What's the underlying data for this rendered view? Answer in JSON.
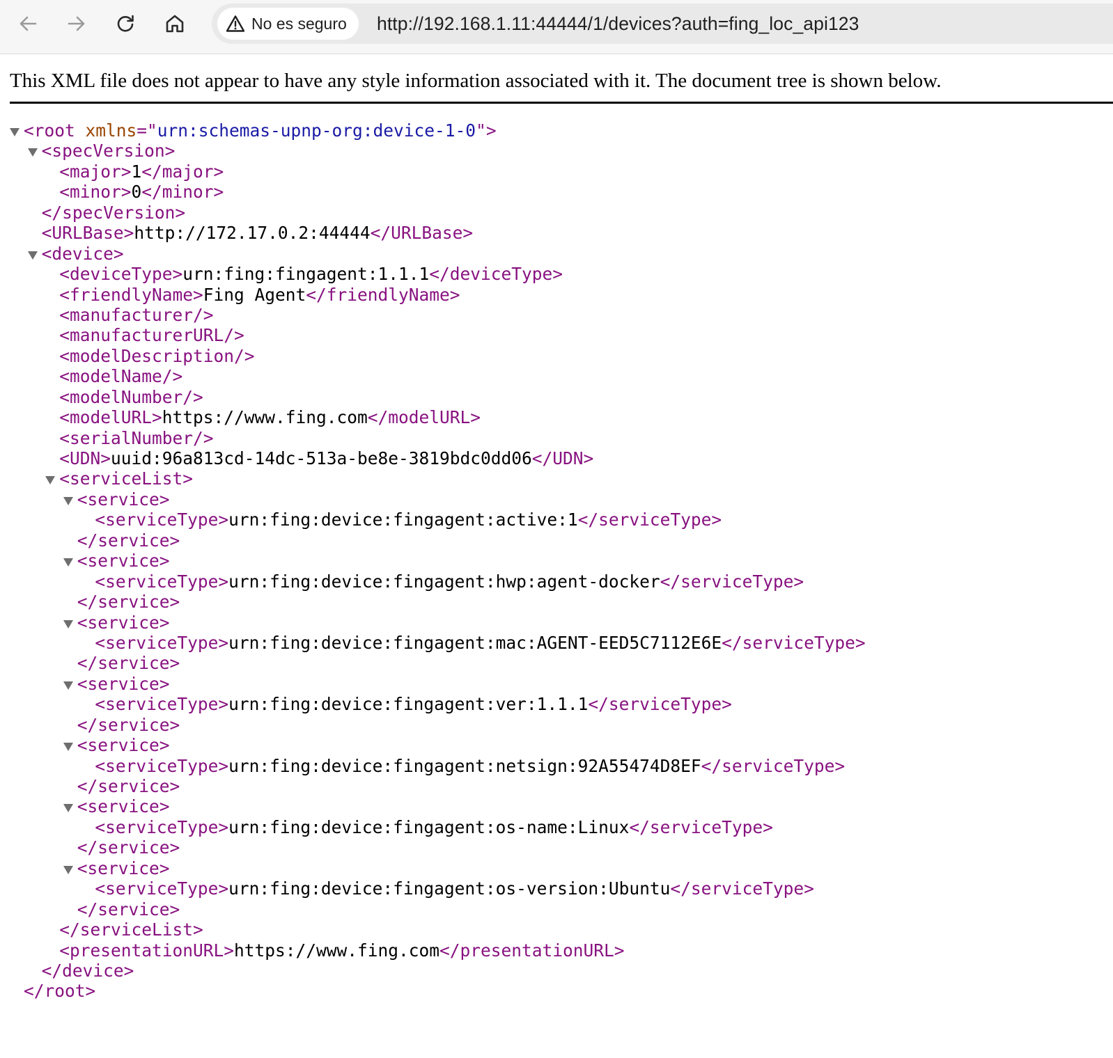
{
  "browser": {
    "security_label": "No es seguro",
    "url": "http://192.168.1.11:44444/1/devices?auth=fing_loc_api123"
  },
  "xml_viewer": {
    "notice": "This XML file does not appear to have any style information associated with it. The document tree is shown below.",
    "lines": [
      {
        "indent": 0,
        "arrow": true,
        "parts": [
          [
            "tag",
            "<root"
          ],
          [
            "an",
            " xmlns"
          ],
          [
            "tag",
            "=\""
          ],
          [
            "av",
            "urn:schemas-upnp-org:device-1-0"
          ],
          [
            "tag",
            "\">"
          ]
        ]
      },
      {
        "indent": 1,
        "arrow": true,
        "parts": [
          [
            "tag",
            "<specVersion>"
          ]
        ]
      },
      {
        "indent": 2,
        "arrow": false,
        "parts": [
          [
            "tag",
            "<major>"
          ],
          [
            "val",
            "1"
          ],
          [
            "tag",
            "</major>"
          ]
        ]
      },
      {
        "indent": 2,
        "arrow": false,
        "parts": [
          [
            "tag",
            "<minor>"
          ],
          [
            "val",
            "0"
          ],
          [
            "tag",
            "</minor>"
          ]
        ]
      },
      {
        "indent": 1,
        "arrow": false,
        "parts": [
          [
            "tag",
            "</specVersion>"
          ]
        ]
      },
      {
        "indent": 1,
        "arrow": false,
        "parts": [
          [
            "tag",
            "<URLBase>"
          ],
          [
            "val",
            "http://172.17.0.2:44444"
          ],
          [
            "tag",
            "</URLBase>"
          ]
        ]
      },
      {
        "indent": 1,
        "arrow": true,
        "parts": [
          [
            "tag",
            "<device>"
          ]
        ]
      },
      {
        "indent": 2,
        "arrow": false,
        "parts": [
          [
            "tag",
            "<deviceType>"
          ],
          [
            "val",
            "urn:fing:fingagent:1.1.1"
          ],
          [
            "tag",
            "</deviceType>"
          ]
        ]
      },
      {
        "indent": 2,
        "arrow": false,
        "parts": [
          [
            "tag",
            "<friendlyName>"
          ],
          [
            "val",
            "Fing Agent"
          ],
          [
            "tag",
            "</friendlyName>"
          ]
        ]
      },
      {
        "indent": 2,
        "arrow": false,
        "parts": [
          [
            "tag",
            "<manufacturer/>"
          ]
        ]
      },
      {
        "indent": 2,
        "arrow": false,
        "parts": [
          [
            "tag",
            "<manufacturerURL/>"
          ]
        ]
      },
      {
        "indent": 2,
        "arrow": false,
        "parts": [
          [
            "tag",
            "<modelDescription/>"
          ]
        ]
      },
      {
        "indent": 2,
        "arrow": false,
        "parts": [
          [
            "tag",
            "<modelName/>"
          ]
        ]
      },
      {
        "indent": 2,
        "arrow": false,
        "parts": [
          [
            "tag",
            "<modelNumber/>"
          ]
        ]
      },
      {
        "indent": 2,
        "arrow": false,
        "parts": [
          [
            "tag",
            "<modelURL>"
          ],
          [
            "val",
            "https://www.fing.com"
          ],
          [
            "tag",
            "</modelURL>"
          ]
        ]
      },
      {
        "indent": 2,
        "arrow": false,
        "parts": [
          [
            "tag",
            "<serialNumber/>"
          ]
        ]
      },
      {
        "indent": 2,
        "arrow": false,
        "parts": [
          [
            "tag",
            "<UDN>"
          ],
          [
            "val",
            "uuid:96a813cd-14dc-513a-be8e-3819bdc0dd06"
          ],
          [
            "tag",
            "</UDN>"
          ]
        ]
      },
      {
        "indent": 2,
        "arrow": true,
        "parts": [
          [
            "tag",
            "<serviceList>"
          ]
        ]
      },
      {
        "indent": 3,
        "arrow": true,
        "parts": [
          [
            "tag",
            "<service>"
          ]
        ]
      },
      {
        "indent": 4,
        "arrow": false,
        "parts": [
          [
            "tag",
            "<serviceType>"
          ],
          [
            "val",
            "urn:fing:device:fingagent:active:1"
          ],
          [
            "tag",
            "</serviceType>"
          ]
        ]
      },
      {
        "indent": 3,
        "arrow": false,
        "parts": [
          [
            "tag",
            "</service>"
          ]
        ]
      },
      {
        "indent": 3,
        "arrow": true,
        "parts": [
          [
            "tag",
            "<service>"
          ]
        ]
      },
      {
        "indent": 4,
        "arrow": false,
        "parts": [
          [
            "tag",
            "<serviceType>"
          ],
          [
            "val",
            "urn:fing:device:fingagent:hwp:agent-docker"
          ],
          [
            "tag",
            "</serviceType>"
          ]
        ]
      },
      {
        "indent": 3,
        "arrow": false,
        "parts": [
          [
            "tag",
            "</service>"
          ]
        ]
      },
      {
        "indent": 3,
        "arrow": true,
        "parts": [
          [
            "tag",
            "<service>"
          ]
        ]
      },
      {
        "indent": 4,
        "arrow": false,
        "parts": [
          [
            "tag",
            "<serviceType>"
          ],
          [
            "val",
            "urn:fing:device:fingagent:mac:AGENT-EED5C7112E6E"
          ],
          [
            "tag",
            "</serviceType>"
          ]
        ]
      },
      {
        "indent": 3,
        "arrow": false,
        "parts": [
          [
            "tag",
            "</service>"
          ]
        ]
      },
      {
        "indent": 3,
        "arrow": true,
        "parts": [
          [
            "tag",
            "<service>"
          ]
        ]
      },
      {
        "indent": 4,
        "arrow": false,
        "parts": [
          [
            "tag",
            "<serviceType>"
          ],
          [
            "val",
            "urn:fing:device:fingagent:ver:1.1.1"
          ],
          [
            "tag",
            "</serviceType>"
          ]
        ]
      },
      {
        "indent": 3,
        "arrow": false,
        "parts": [
          [
            "tag",
            "</service>"
          ]
        ]
      },
      {
        "indent": 3,
        "arrow": true,
        "parts": [
          [
            "tag",
            "<service>"
          ]
        ]
      },
      {
        "indent": 4,
        "arrow": false,
        "parts": [
          [
            "tag",
            "<serviceType>"
          ],
          [
            "val",
            "urn:fing:device:fingagent:netsign:92A55474D8EF"
          ],
          [
            "tag",
            "</serviceType>"
          ]
        ]
      },
      {
        "indent": 3,
        "arrow": false,
        "parts": [
          [
            "tag",
            "</service>"
          ]
        ]
      },
      {
        "indent": 3,
        "arrow": true,
        "parts": [
          [
            "tag",
            "<service>"
          ]
        ]
      },
      {
        "indent": 4,
        "arrow": false,
        "parts": [
          [
            "tag",
            "<serviceType>"
          ],
          [
            "val",
            "urn:fing:device:fingagent:os-name:Linux"
          ],
          [
            "tag",
            "</serviceType>"
          ]
        ]
      },
      {
        "indent": 3,
        "arrow": false,
        "parts": [
          [
            "tag",
            "</service>"
          ]
        ]
      },
      {
        "indent": 3,
        "arrow": true,
        "parts": [
          [
            "tag",
            "<service>"
          ]
        ]
      },
      {
        "indent": 4,
        "arrow": false,
        "parts": [
          [
            "tag",
            "<serviceType>"
          ],
          [
            "val",
            "urn:fing:device:fingagent:os-version:Ubuntu"
          ],
          [
            "tag",
            "</serviceType>"
          ]
        ]
      },
      {
        "indent": 3,
        "arrow": false,
        "parts": [
          [
            "tag",
            "</service>"
          ]
        ]
      },
      {
        "indent": 2,
        "arrow": false,
        "parts": [
          [
            "tag",
            "</serviceList>"
          ]
        ]
      },
      {
        "indent": 2,
        "arrow": false,
        "parts": [
          [
            "tag",
            "<presentationURL>"
          ],
          [
            "val",
            "https://www.fing.com"
          ],
          [
            "tag",
            "</presentationURL>"
          ]
        ]
      },
      {
        "indent": 1,
        "arrow": false,
        "parts": [
          [
            "tag",
            "</device>"
          ]
        ]
      },
      {
        "indent": 0,
        "arrow": false,
        "parts": [
          [
            "tag",
            "</root>"
          ]
        ]
      }
    ]
  },
  "colors": {
    "tag": "#881280",
    "attribute_name": "#994500",
    "attribute_value": "#1a1aa6",
    "text": "#000000"
  },
  "icons": {
    "back": "arrow-left-icon",
    "forward": "arrow-right-icon",
    "reload": "reload-icon",
    "home": "home-icon",
    "security": "warning-triangle-icon"
  }
}
